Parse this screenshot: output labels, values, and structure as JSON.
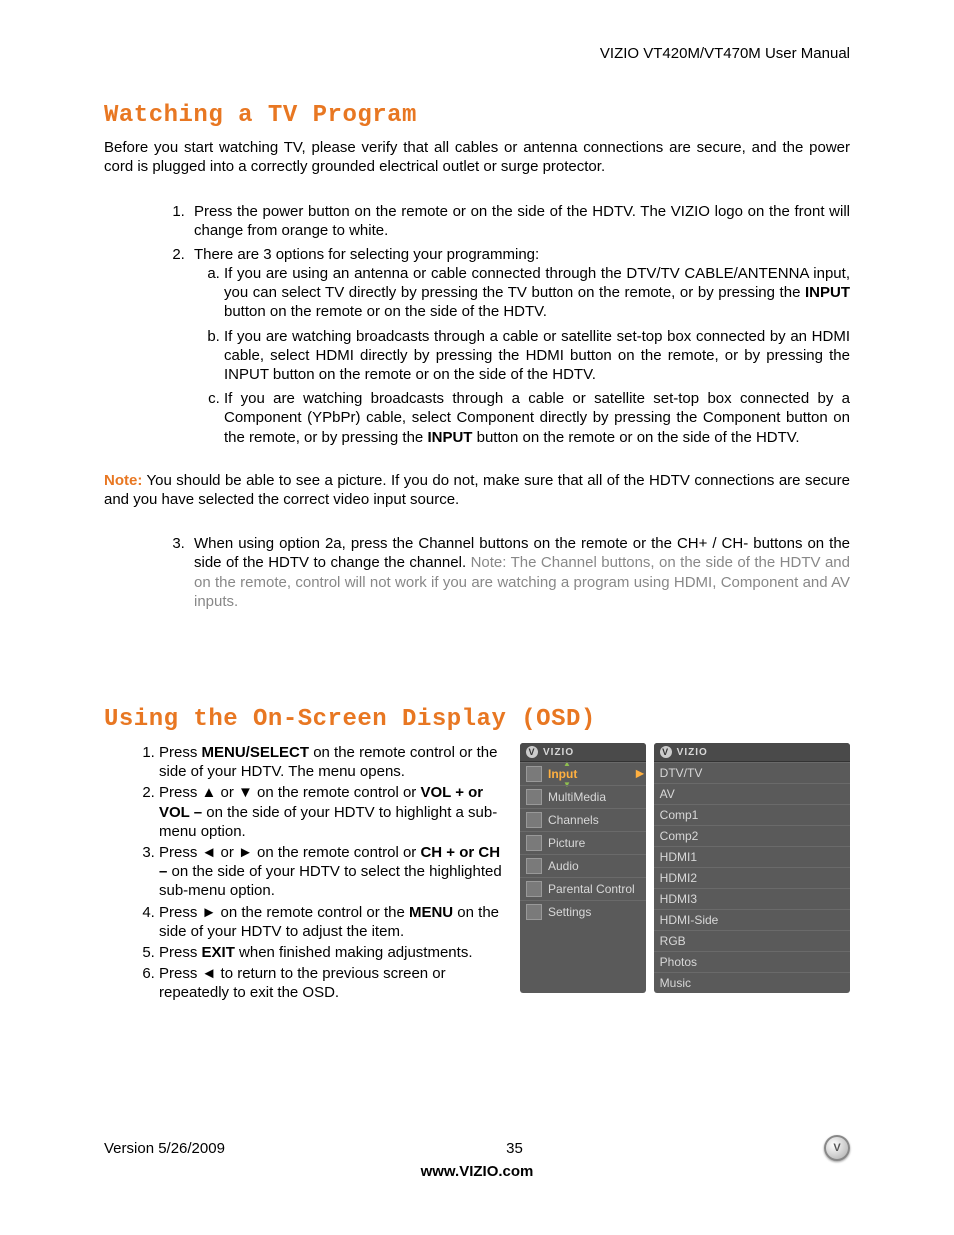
{
  "header": "VIZIO VT420M/VT470M User Manual",
  "section1": {
    "heading": "Watching a TV Program",
    "intro": "Before you start watching TV, please verify that all cables or antenna connections are secure, and the power cord is plugged into a correctly grounded electrical outlet or surge protector.",
    "step1": "Press the power button on the remote or on the side of the HDTV.  The VIZIO logo on the front will change from orange to white.",
    "step2": "There are 3 options for selecting your programming:",
    "step2a_pre": "If you are using an antenna or cable connected through the DTV/TV CABLE/ANTENNA input, you can select TV directly by pressing the TV button on the remote, or by pressing the ",
    "step2a_bold": "INPUT",
    "step2a_post": " button on the remote or on the side of the HDTV.",
    "step2b": "If you are watching broadcasts through a cable or satellite set-top box connected by an HDMI cable, select HDMI directly by pressing the HDMI button on the remote, or by pressing the INPUT button on the remote or on the side of the HDTV.",
    "step2c_pre": "If you are watching broadcasts through a cable or satellite set-top box connected by a Component (YPbPr) cable, select Component directly by pressing the Component button on the remote, or by pressing the ",
    "step2c_bold": "INPUT",
    "step2c_post": " button on the remote or on the side of the HDTV.",
    "note_label": "Note:",
    "note_text": " You should be able to see a picture.  If you do not, make sure that all of the HDTV connections are secure and you have selected the correct video input source.",
    "step3_black": "When using option 2a, press the Channel buttons on the remote or the CH+ / CH- buttons on the side of the HDTV to change the channel.  ",
    "step3_gray": "Note: The Channel buttons, on the side of the HDTV and on the remote, control will not work if you are watching a program using HDMI, Component and AV inputs."
  },
  "section2": {
    "heading": "Using the On-Screen Display (OSD)",
    "s1_a": "Press ",
    "s1_b": "MENU/SELECT",
    "s1_c": " on the remote control or the side of your HDTV. The menu opens.",
    "s2_a": "Press ▲ or ▼ on the remote control or ",
    "s2_b": "VOL + or VOL –",
    "s2_c": " on the side of your HDTV to highlight a sub-menu option.",
    "s3_a": "Press ◄ or ► on the remote control or ",
    "s3_b": "CH + or CH –",
    "s3_c": " on the side of your HDTV to select the highlighted sub-menu option.",
    "s4_a": "Press ► on the remote control or the ",
    "s4_b": "MENU",
    "s4_c": " on the side of your HDTV to adjust the item.",
    "s5_a": "Press ",
    "s5_b": "EXIT",
    "s5_c": " when finished making adjustments.",
    "s6": "Press ◄ to return to the previous screen or repeatedly to exit the OSD."
  },
  "osd": {
    "brand": "VIZIO",
    "left_items": [
      "Input",
      "MultiMedia",
      "Channels",
      "Picture",
      "Audio",
      "Parental Control",
      "Settings"
    ],
    "right_items": [
      "DTV/TV",
      "AV",
      "Comp1",
      "Comp2",
      "HDMI1",
      "HDMI2",
      "HDMI3",
      "HDMI-Side",
      "RGB",
      "Photos",
      "Music"
    ]
  },
  "footer": {
    "version": "Version 5/26/2009",
    "page": "35",
    "url": "www.VIZIO.com"
  }
}
